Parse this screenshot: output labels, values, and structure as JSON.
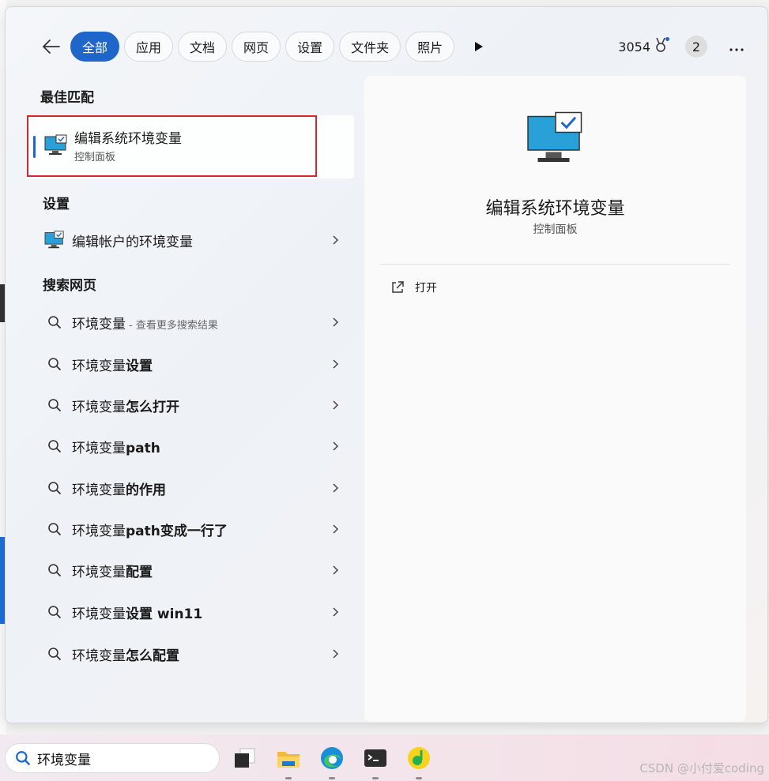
{
  "filters": {
    "tabs": [
      "全部",
      "应用",
      "文档",
      "网页",
      "设置",
      "文件夹",
      "照片"
    ],
    "active_index": 0
  },
  "header": {
    "points": "3054",
    "badge_count": "2"
  },
  "best_match": {
    "heading": "最佳匹配",
    "title": "编辑系统环境变量",
    "subtitle": "控制面板"
  },
  "settings": {
    "heading": "设置",
    "items": [
      {
        "label": "编辑帐户的环境变量"
      }
    ]
  },
  "web": {
    "heading": "搜索网页",
    "first": {
      "prefix": "环境变量",
      "hint": "- 查看更多搜索结果"
    },
    "items": [
      {
        "prefix": "环境变量",
        "bold": "设置"
      },
      {
        "prefix": "环境变量",
        "bold": "怎么打开"
      },
      {
        "prefix": "环境变量",
        "bold": "path"
      },
      {
        "prefix": "环境变量",
        "bold": "的作用"
      },
      {
        "prefix": "环境变量",
        "bold": "path变成一行了"
      },
      {
        "prefix": "环境变量",
        "bold": "配置"
      },
      {
        "prefix": "环境变量",
        "bold": "设置 win11"
      },
      {
        "prefix": "环境变量",
        "bold": "怎么配置"
      }
    ]
  },
  "preview": {
    "title": "编辑系统环境变量",
    "subtitle": "控制面板",
    "action_label": "打开"
  },
  "taskbar": {
    "search_value": "环境变量",
    "watermark": "CSDN @小付爱coding"
  },
  "colors": {
    "accent": "#1e66c9",
    "highlight_box": "#d8262c"
  }
}
